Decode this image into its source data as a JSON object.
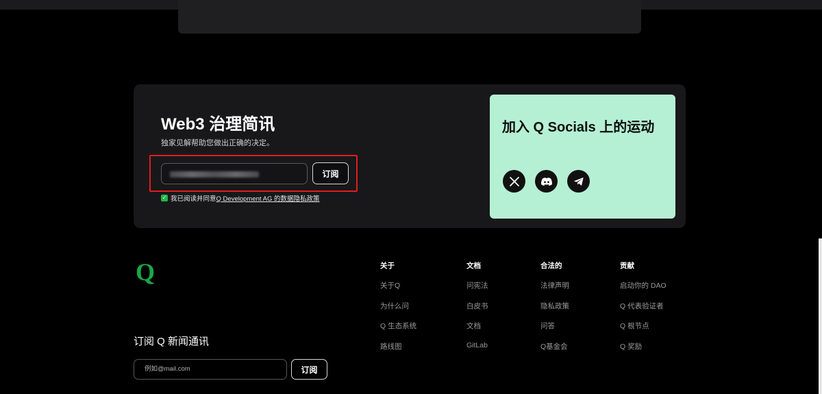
{
  "newsletter": {
    "title": "Web3 治理简讯",
    "subtitle": "独家见解帮助您做出正确的决定。",
    "subscribe_label": "订阅",
    "consent_prefix": "我已阅读并同意",
    "consent_link": "Q Development AG 的数据隐私政策",
    "consent_checked": true
  },
  "social": {
    "title": "加入 Q Socials 上的运动",
    "icons": [
      "x-icon",
      "discord-icon",
      "telegram-icon"
    ]
  },
  "footer": {
    "columns": [
      {
        "heading": "关于",
        "links": [
          "关于Q",
          "为什么问",
          "Q 生态系统",
          "路线图"
        ]
      },
      {
        "heading": "文档",
        "links": [
          "问宪法",
          "白皮书",
          "文档",
          "GitLab"
        ]
      },
      {
        "heading": "合法的",
        "links": [
          "法律声明",
          "隐私政策",
          "问答",
          "Q基金会"
        ]
      },
      {
        "heading": "贡献",
        "links": [
          "启动你的 DAO",
          "Q 代表验证者",
          "Q 根节点",
          "Q 奖励"
        ]
      }
    ],
    "subscribe_title": "订阅 Q 新闻通讯",
    "email_placeholder": "例如@mail.com",
    "subscribe_label": "订阅"
  },
  "colors": {
    "accent_green": "#23b34a",
    "social_card_bg": "#b6f0d4",
    "highlight_red": "#e01e1e"
  }
}
